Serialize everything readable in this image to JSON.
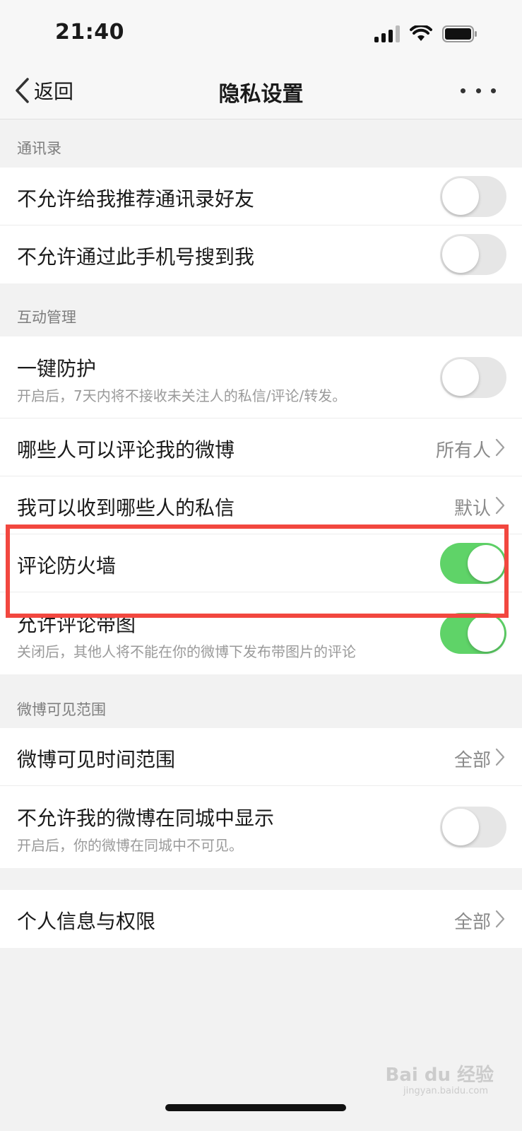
{
  "status_bar": {
    "time": "21:40"
  },
  "nav": {
    "back_label": "返回",
    "title": "隐私设置"
  },
  "sections": {
    "contacts": {
      "header": "通讯录",
      "rows": [
        {
          "title": "不允许给我推荐通讯录好友",
          "toggle_on": false
        },
        {
          "title": "不允许通过此手机号搜到我",
          "toggle_on": false
        }
      ]
    },
    "interaction": {
      "header": "互动管理",
      "rows": [
        {
          "title": "一键防护",
          "subtitle": "开启后，7天内将不接收未关注人的私信/评论/转发。",
          "toggle_on": false
        },
        {
          "title": "哪些人可以评论我的微博",
          "value": "所有人"
        },
        {
          "title": "我可以收到哪些人的私信",
          "value": "默认"
        },
        {
          "title": "评论防火墙",
          "toggle_on": true
        },
        {
          "title": "允许评论带图",
          "subtitle": "关闭后，其他人将不能在你的微博下发布带图片的评论",
          "toggle_on": true
        }
      ]
    },
    "visibility": {
      "header": "微博可见范围",
      "rows": [
        {
          "title": "微博可见时间范围",
          "value": "全部"
        },
        {
          "title": "不允许我的微博在同城中显示",
          "subtitle": "开启后，你的微博在同城中不可见。",
          "toggle_on": false
        }
      ]
    },
    "personal": {
      "rows": [
        {
          "title": "个人信息与权限",
          "value": "全部"
        }
      ]
    }
  },
  "watermark": {
    "text": "Bai du 经验",
    "sub": "jingyan.baidu.com"
  },
  "colors": {
    "toggle_on": "#5fd368",
    "toggle_off": "#e6e6e6",
    "highlight": "#f2473f"
  }
}
